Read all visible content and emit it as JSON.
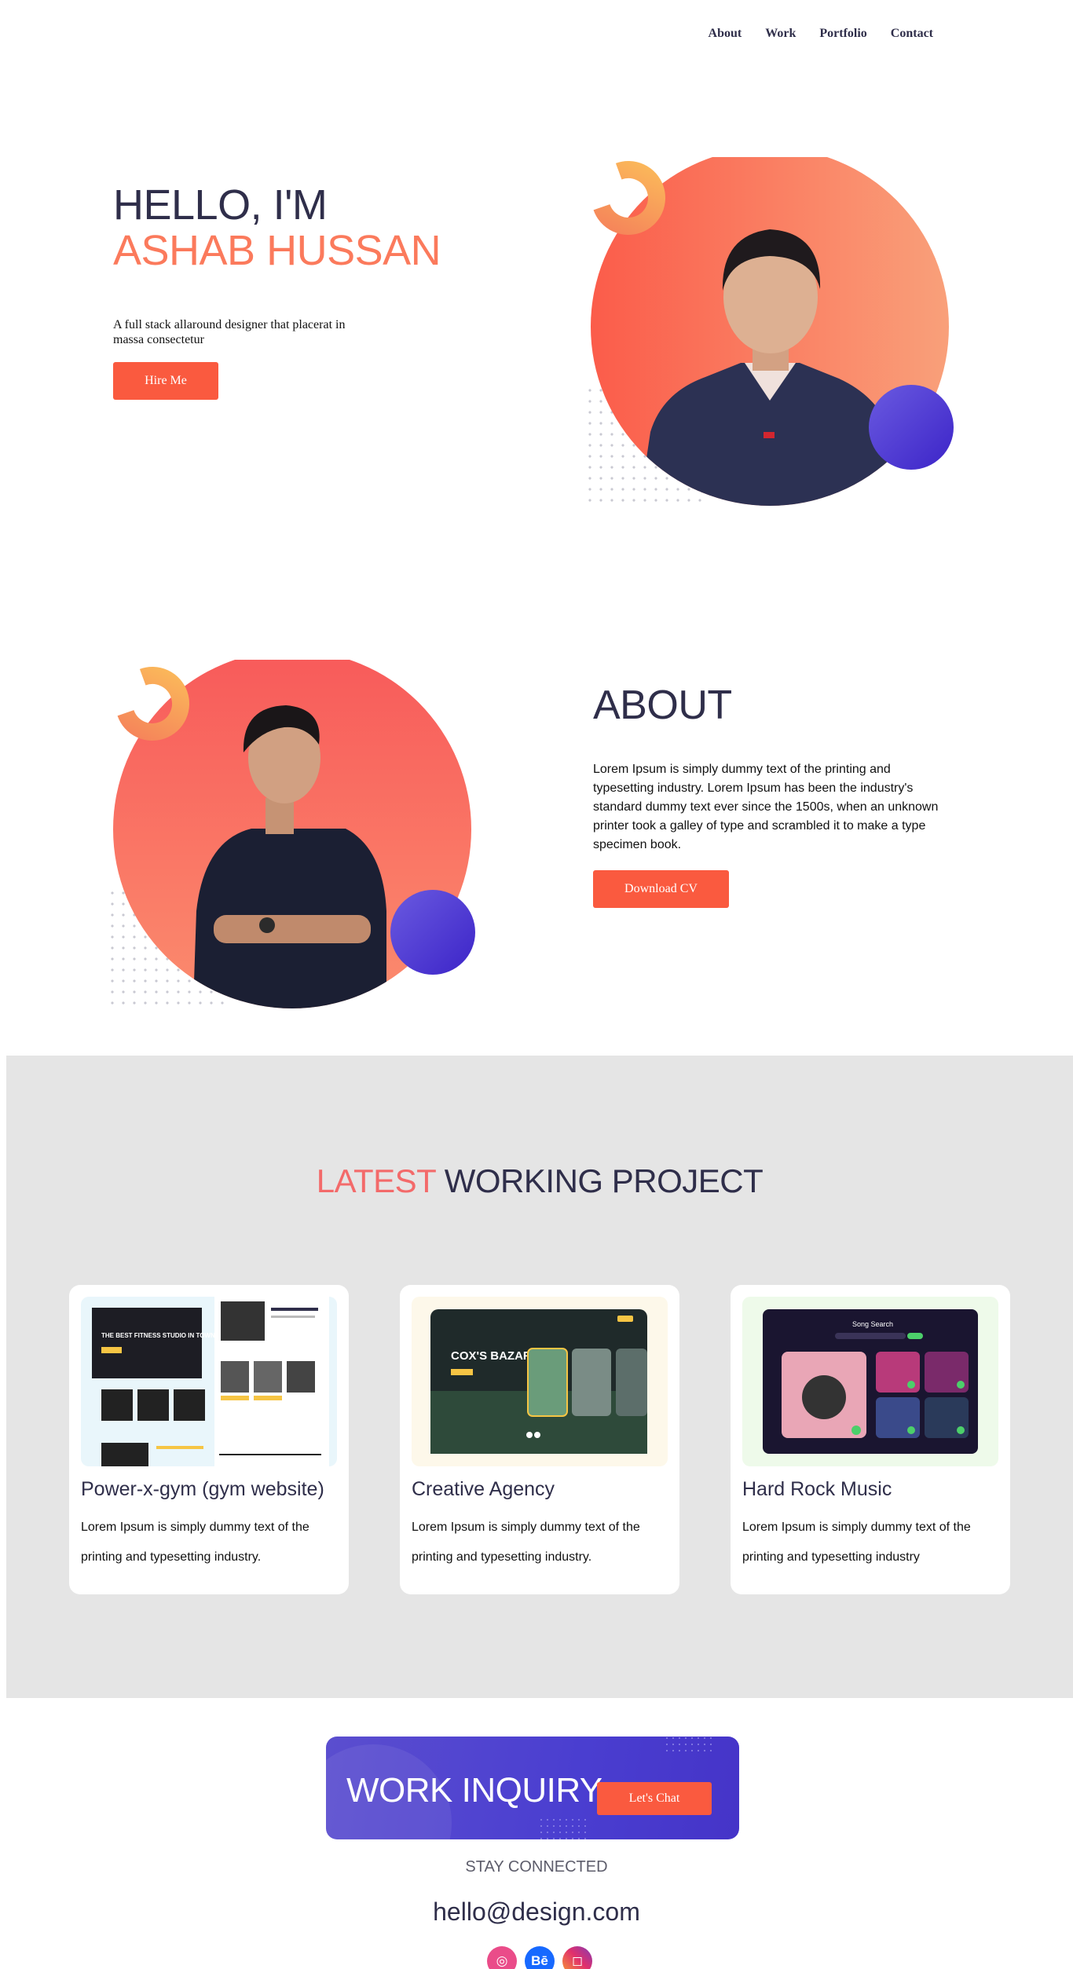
{
  "nav": {
    "items": [
      "About",
      "Work",
      "Portfolio",
      "Contact"
    ]
  },
  "hero": {
    "greeting": "HELLO, I'M",
    "name": "ASHAB HUSSAN",
    "description": "A full stack allaround designer that placerat in massa consectetur",
    "button_label": "Hire Me"
  },
  "about": {
    "title": "ABOUT",
    "body": "Lorem Ipsum is simply dummy text of the printing and typesetting industry. Lorem Ipsum has been the industry's standard dummy text ever since the 1500s, when an unknown printer took a galley of type and scrambled it to make a type specimen book.",
    "button_label": "Download CV"
  },
  "projects": {
    "title_accent": "LATEST",
    "title_rest": " WORKING PROJECT",
    "cards": [
      {
        "title": "Power-x-gym (gym website)",
        "description": "Lorem Ipsum is simply dummy text of the printing and typesetting industry.",
        "thumb_text": "THE BEST FITNESS STUDIO IN TOWN"
      },
      {
        "title": "Creative Agency",
        "description": "Lorem Ipsum is simply dummy text of the printing and typesetting industry.",
        "thumb_text": "COX'S BAZAR"
      },
      {
        "title": "Hard Rock Music",
        "description": "Lorem Ipsum is simply dummy text of the printing and typesetting industry",
        "thumb_text": "Song Search"
      }
    ]
  },
  "inquiry": {
    "title": "WORK INQUIRY",
    "button_label": "Let's Chat"
  },
  "footer": {
    "stay_connected": "STAY CONNECTED",
    "email": "hello@design.com",
    "socials": [
      {
        "name": "dribbble",
        "glyph": "◎",
        "icon": "dribbble-icon"
      },
      {
        "name": "behance",
        "glyph": "Bē",
        "icon": "behance-icon"
      },
      {
        "name": "instagram",
        "glyph": "◻",
        "icon": "instagram-icon"
      }
    ]
  },
  "colors": {
    "accent": "#fa5a3f",
    "heading": "#2f2e4a",
    "name_orange": "#fb7a5c",
    "purple": "#4a3ed0",
    "projects_bg": "#e5e5e5"
  }
}
